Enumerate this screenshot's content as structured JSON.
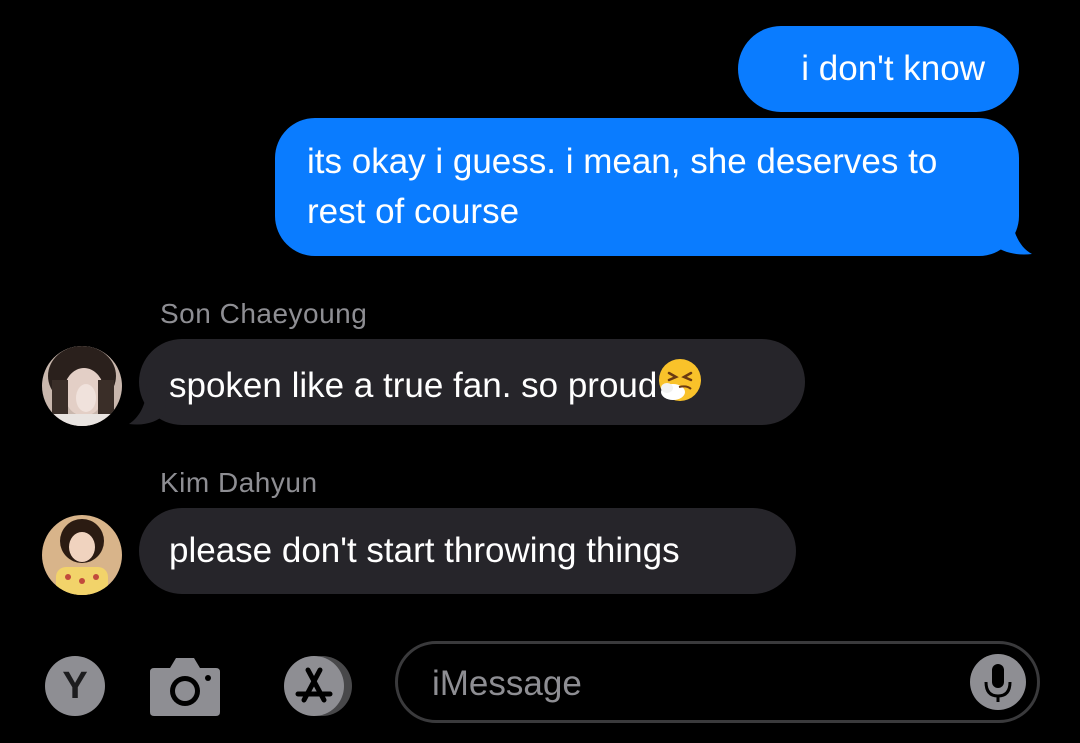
{
  "messages": [
    {
      "direction": "sent",
      "text": "i don't know"
    },
    {
      "direction": "sent",
      "text": "its okay i guess. i mean, she deserves to rest of course"
    },
    {
      "direction": "received",
      "sender": "Son Chaeyoung",
      "text": "spoken like a true fan. so proud",
      "emoji": "sneezing-face"
    },
    {
      "direction": "received",
      "sender": "Kim Dahyun",
      "text": "please don't start throwing things"
    }
  ],
  "input_bar": {
    "apps_button_label": "Y",
    "placeholder": "iMessage",
    "icons": [
      "camera-icon",
      "app-store-icon",
      "microphone-icon"
    ]
  },
  "colors": {
    "sent_bubble": "#0a7cff",
    "received_bubble": "#26252a",
    "background": "#000000",
    "secondary_text": "#8e8e93"
  }
}
